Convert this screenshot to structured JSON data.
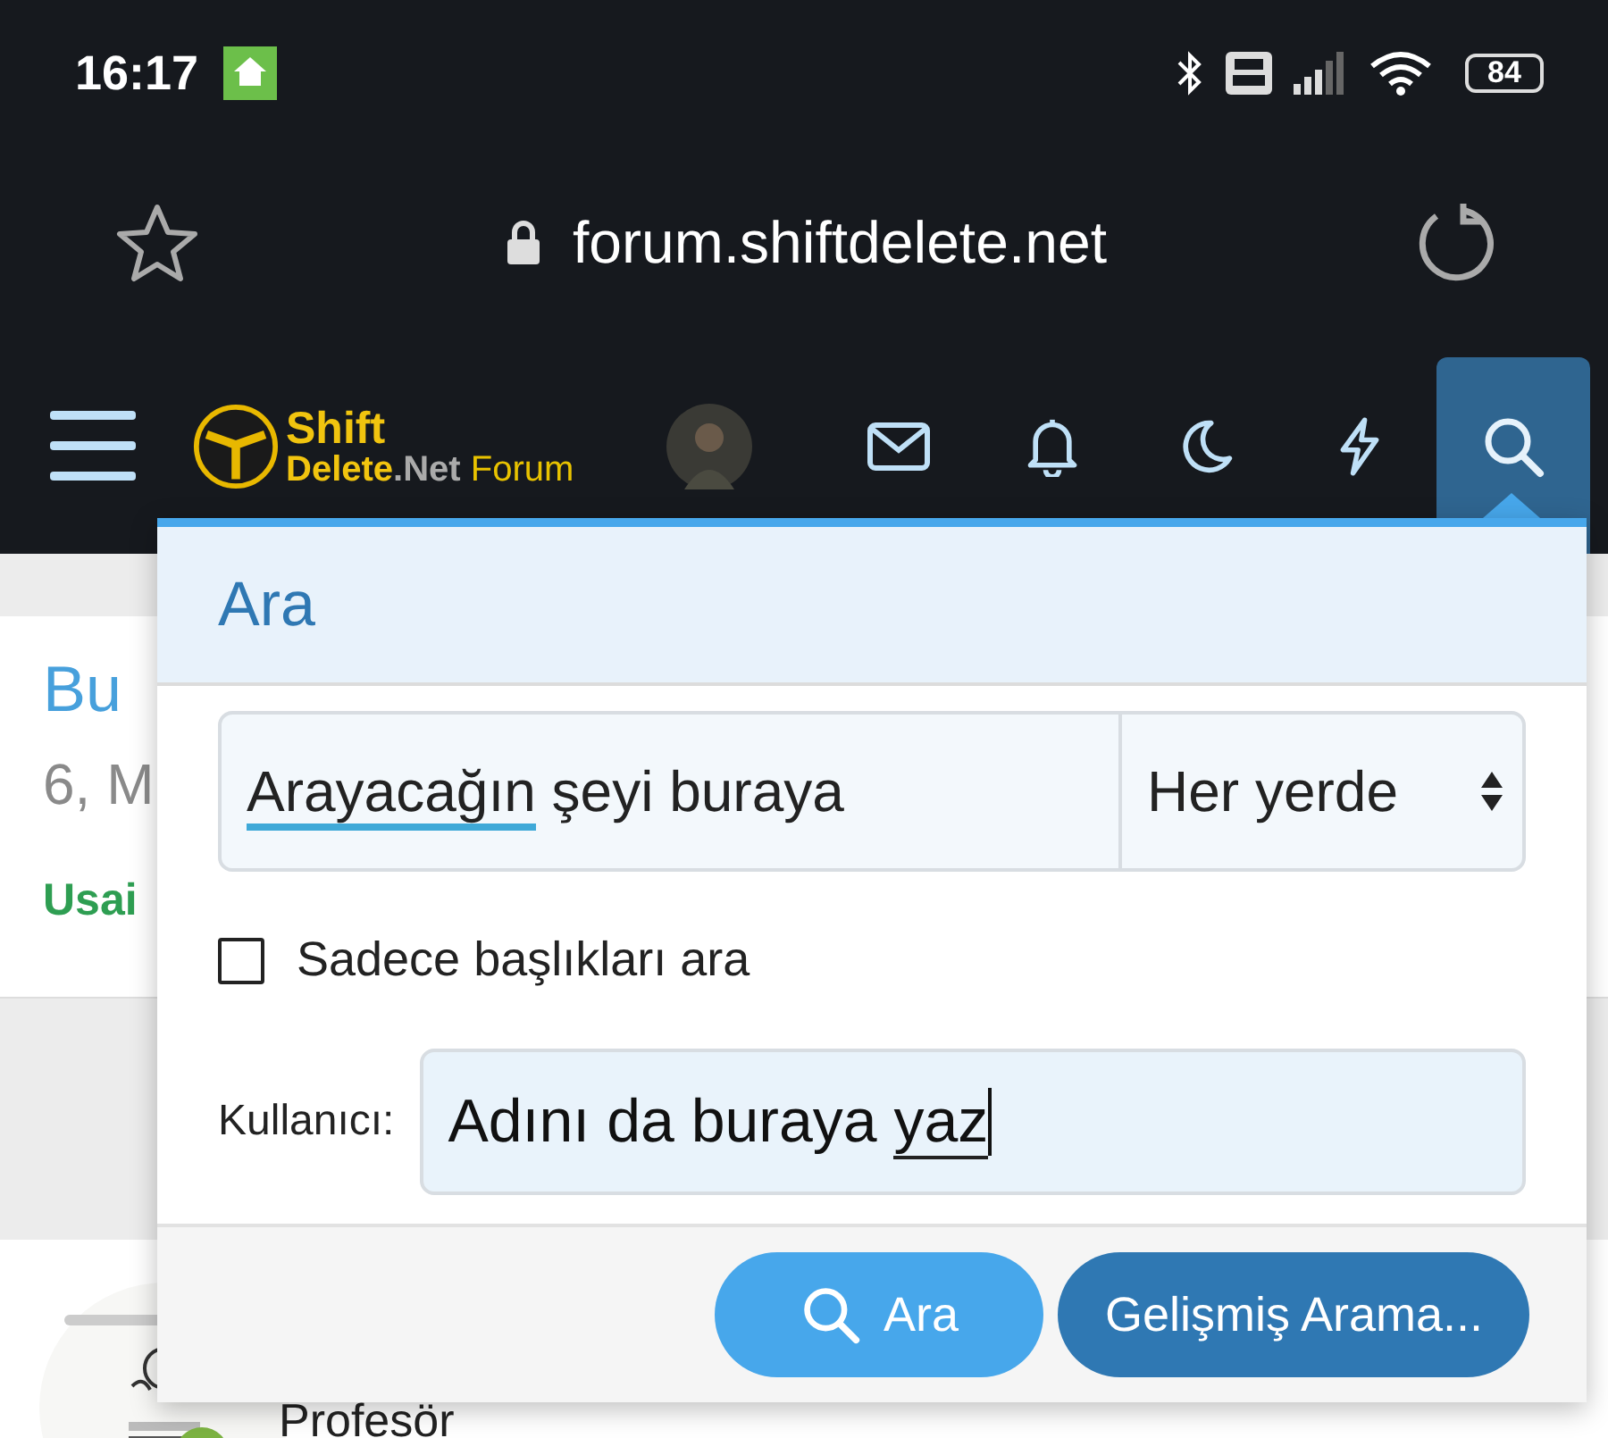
{
  "status_bar": {
    "time": "16:17",
    "battery": "84"
  },
  "browser": {
    "url": "forum.shiftdelete.net"
  },
  "nav": {
    "logo": {
      "top": "Shift",
      "brand": "Delete",
      "suffix": ".Net",
      "label": "Forum"
    },
    "icons": [
      {
        "kind": "mail",
        "selected": false
      },
      {
        "kind": "bell",
        "selected": false
      },
      {
        "kind": "moon",
        "selected": false
      },
      {
        "kind": "bolt",
        "selected": false
      },
      {
        "kind": "search",
        "selected": true
      }
    ]
  },
  "background": {
    "title": "Bu",
    "date": "6, M",
    "author": "Usai",
    "member_title": "Profesör"
  },
  "search_popup": {
    "title": "Ara",
    "query": {
      "value": "Arayacağın şeyi buraya"
    },
    "scope": {
      "value": "Her yerde"
    },
    "titles_only": {
      "label": "Sadece başlıkları ara",
      "checked": false
    },
    "user": {
      "label": "Kullanıcı:",
      "value": "Adını da buraya yaz"
    },
    "buttons": [
      {
        "label": "Ara",
        "kind": "primary"
      },
      {
        "label": "Gelişmiş Arama...",
        "kind": "secondary"
      }
    ]
  }
}
